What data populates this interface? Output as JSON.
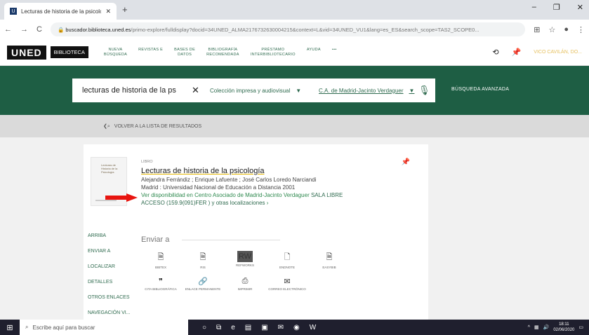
{
  "browser": {
    "tab_title": "Lecturas de historia de la psicolo",
    "favicon": "U",
    "url_host": "buscador.biblioteca.uned.es",
    "url_path": "/primo-explore/fulldisplay?docid=34UNED_ALMA2176732630004215&context=L&vid=34UNED_VU1&lang=es_ES&search_scope=TAS2_SCOPE0..."
  },
  "nav": {
    "logo": "UNED",
    "library": "BIBLIOTECA",
    "menu": [
      {
        "l1": "NUEVA",
        "l2": "BÚSQUEDA"
      },
      {
        "l1": "REVISTAS E",
        "l2": ""
      },
      {
        "l1": "BASES DE",
        "l2": "DATOS"
      },
      {
        "l1": "BIBLIOGRAFÍA",
        "l2": "RECOMENDADA"
      },
      {
        "l1": "PRÉSTAMO",
        "l2": "INTERBIBLIOTECARIO"
      },
      {
        "l1": "AYUDA",
        "l2": ""
      },
      {
        "l1": "•••",
        "l2": ""
      }
    ],
    "user": "VICO CAVILÁN, DO..."
  },
  "search": {
    "query": "lecturas de historia de la ps",
    "collection": "Colección impresa y audiovisual",
    "library": "C.A. de Madrid-Jacinto Verdaguer",
    "advanced": "BÚSQUEDA AVANZADA"
  },
  "back_label": "VOLVER A LA LISTA DE RESULTADOS",
  "record": {
    "type": "LIBRO",
    "title": "Lecturas de historia de la psicología",
    "authors": "Alejandra Ferrándiz ; Enrique Lafuente ; José Carlos Loredo Narciandi",
    "publisher": "Madrid : Universidad Nacional de Educación a Distancia 2001",
    "availability_prefix": "Ver disponibilidad en",
    "availability_center": "Centro Asociado de Madrid-Jacinto Verdaguer",
    "availability_room": "SALA LIBRE",
    "availability_line2": "ACCESO (159.9(091)FER ) y otras localizaciones",
    "thumb_text": "Lecturas de Historia de la Psicología"
  },
  "sidebar": [
    "ARRIBA",
    "ENVIAR A",
    "LOCALIZAR",
    "DETALLES",
    "OTROS ENLACES",
    "NAVEGACIÓN VI..."
  ],
  "send": {
    "heading": "Enviar a",
    "actions": [
      {
        "label": "BIBTEX"
      },
      {
        "label": "RIS"
      },
      {
        "label": "REFWORKS",
        "badge": "RW"
      },
      {
        "label": "ENDNOTE"
      },
      {
        "label": "EASYBIB"
      },
      {
        "label": "CITA BIBLIOGRÁFICA"
      },
      {
        "label": "ENLACE PERMANENTE"
      },
      {
        "label": "IMPRIMIR"
      },
      {
        "label": "CORREO ELECTRÓNICO"
      }
    ]
  },
  "taskbar": {
    "search_placeholder": "Escribe aquí para buscar",
    "time": "18:11",
    "date": "02/06/2020"
  },
  "colors": {
    "brand": "#1e5e44",
    "link": "#2f6b4f",
    "arrow": "#e8140f"
  }
}
